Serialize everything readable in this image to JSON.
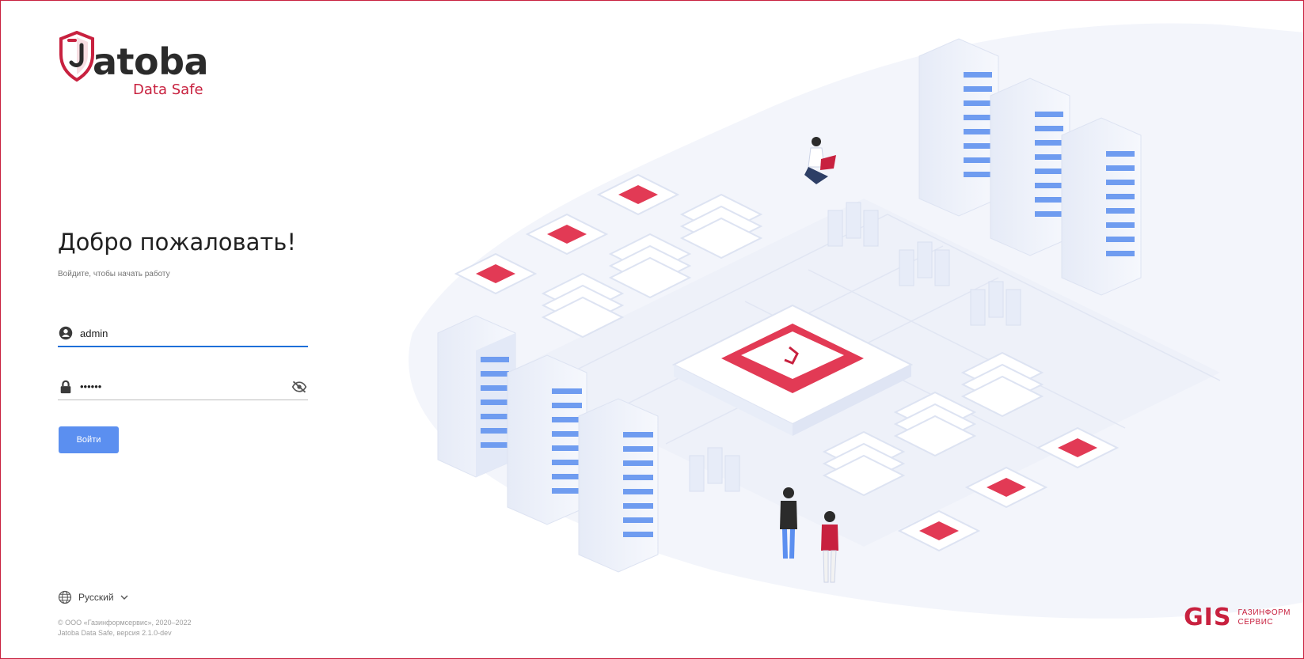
{
  "brand": {
    "name": "atoba",
    "subtitle": "Data Safe",
    "accent_color": "#c8213f"
  },
  "login": {
    "title": "Добро пожаловать!",
    "subtitle": "Войдите, чтобы начать работу",
    "username_value": "admin",
    "password_value": "••••••",
    "user_icon": "account-circle-icon",
    "lock_icon": "lock-icon",
    "eye_icon": "eye-off-icon",
    "submit_label": "Войти",
    "button_color": "#5b8ff0"
  },
  "footer": {
    "language_label": "Русский",
    "copyright_line1": "© ООО «Газинформсервис», 2020–2022",
    "copyright_line2": "Jatoba Data Safe, версия 2.1.0-dev"
  },
  "partner": {
    "mark": "GIS",
    "line1": "ГАЗИНФОРМ",
    "line2": "СЕРВИС"
  }
}
